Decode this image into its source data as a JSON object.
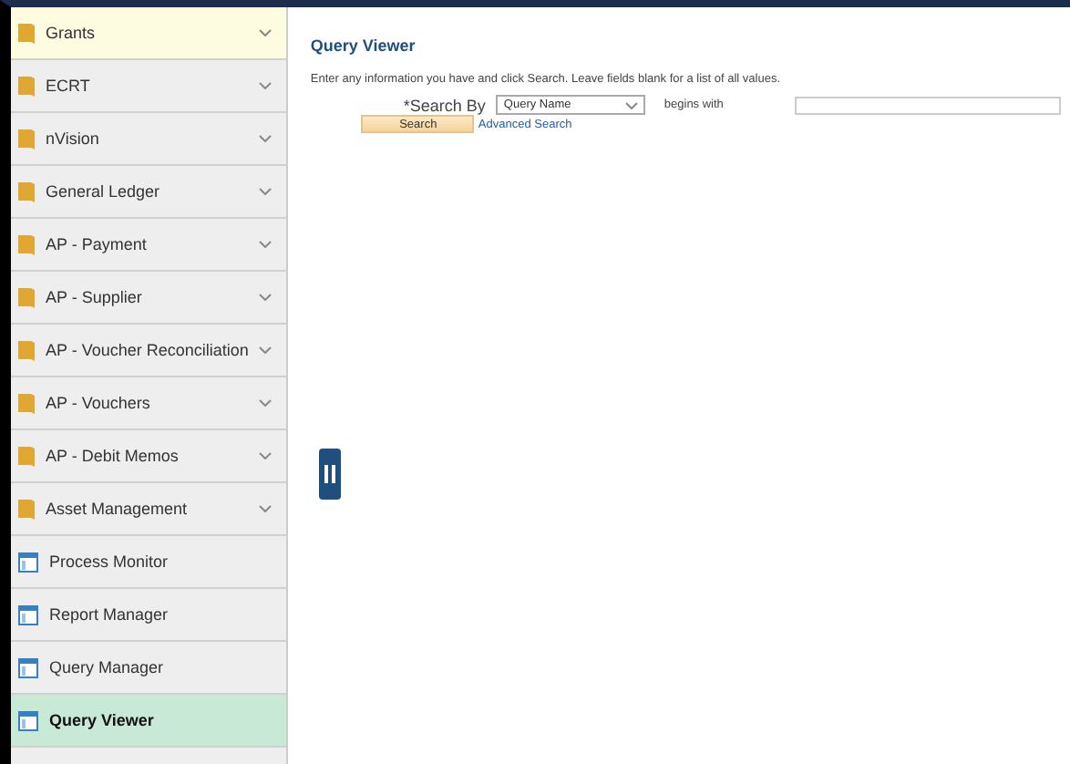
{
  "sidebar": {
    "items": [
      {
        "label": "Grants",
        "kind": "folder",
        "selected": false,
        "hovered": true,
        "expandable": true
      },
      {
        "label": "ECRT",
        "kind": "folder",
        "selected": false,
        "hovered": false,
        "expandable": true
      },
      {
        "label": "nVision",
        "kind": "folder",
        "selected": false,
        "hovered": false,
        "expandable": true
      },
      {
        "label": "General Ledger",
        "kind": "folder",
        "selected": false,
        "hovered": false,
        "expandable": true
      },
      {
        "label": "AP - Payment",
        "kind": "folder",
        "selected": false,
        "hovered": false,
        "expandable": true
      },
      {
        "label": "AP - Supplier",
        "kind": "folder",
        "selected": false,
        "hovered": false,
        "expandable": true
      },
      {
        "label": "AP - Voucher Reconciliation",
        "kind": "folder",
        "selected": false,
        "hovered": false,
        "expandable": true
      },
      {
        "label": "AP - Vouchers",
        "kind": "folder",
        "selected": false,
        "hovered": false,
        "expandable": true
      },
      {
        "label": "AP - Debit Memos",
        "kind": "folder",
        "selected": false,
        "hovered": false,
        "expandable": true
      },
      {
        "label": "Asset Management",
        "kind": "folder",
        "selected": false,
        "hovered": false,
        "expandable": true
      },
      {
        "label": "Process Monitor",
        "kind": "page",
        "selected": false,
        "hovered": false,
        "expandable": false
      },
      {
        "label": "Report Manager",
        "kind": "page",
        "selected": false,
        "hovered": false,
        "expandable": false
      },
      {
        "label": "Query Manager",
        "kind": "page",
        "selected": false,
        "hovered": false,
        "expandable": false
      },
      {
        "label": "Query Viewer",
        "kind": "page",
        "selected": true,
        "hovered": false,
        "expandable": false
      }
    ]
  },
  "main": {
    "title": "Query Viewer",
    "instructions": "Enter any information you have and click Search. Leave fields blank for a list of all values.",
    "search_by_label": "*Search By",
    "search_by_value": "Query Name",
    "operator": "begins with",
    "search_button": "Search",
    "advanced_link": "Advanced Search"
  }
}
